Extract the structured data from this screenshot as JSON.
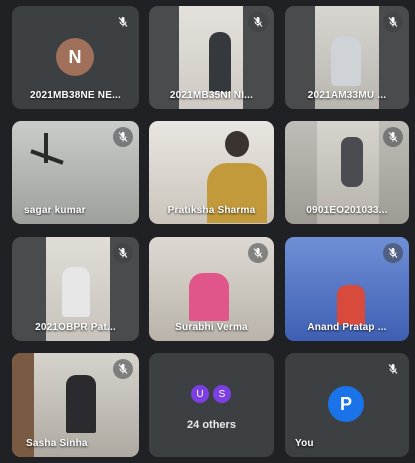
{
  "colors": {
    "background": "#202124",
    "tile": "#3c4043",
    "avatar_n": "#a0705a",
    "avatar_u": "#7b3fe4",
    "avatar_s": "#7b3fe4",
    "avatar_p": "#1a73e8"
  },
  "participants": [
    {
      "name": "2021MB38NE NE...",
      "avatar_letter": "N",
      "muted": true
    },
    {
      "name": "2021MB35NI NI...",
      "muted": true
    },
    {
      "name": "2021AM33MU ...",
      "muted": true
    },
    {
      "name": "sagar kumar",
      "muted": true
    },
    {
      "name": "Pratiksha Sharma",
      "muted": false
    },
    {
      "name": "0901EO201033...",
      "muted": true
    },
    {
      "name": "2021OBPR Pat...",
      "muted": true
    },
    {
      "name": "Surabhi Verma",
      "muted": true
    },
    {
      "name": "Anand Pratap ...",
      "muted": true
    },
    {
      "name": "Sasha Sinha",
      "muted": true
    }
  ],
  "others": {
    "initials": [
      "U",
      "S"
    ],
    "label": "24 others"
  },
  "self": {
    "avatar_letter": "P",
    "name": "You",
    "muted": true
  },
  "icons": {
    "mute": "mic-off-icon"
  }
}
